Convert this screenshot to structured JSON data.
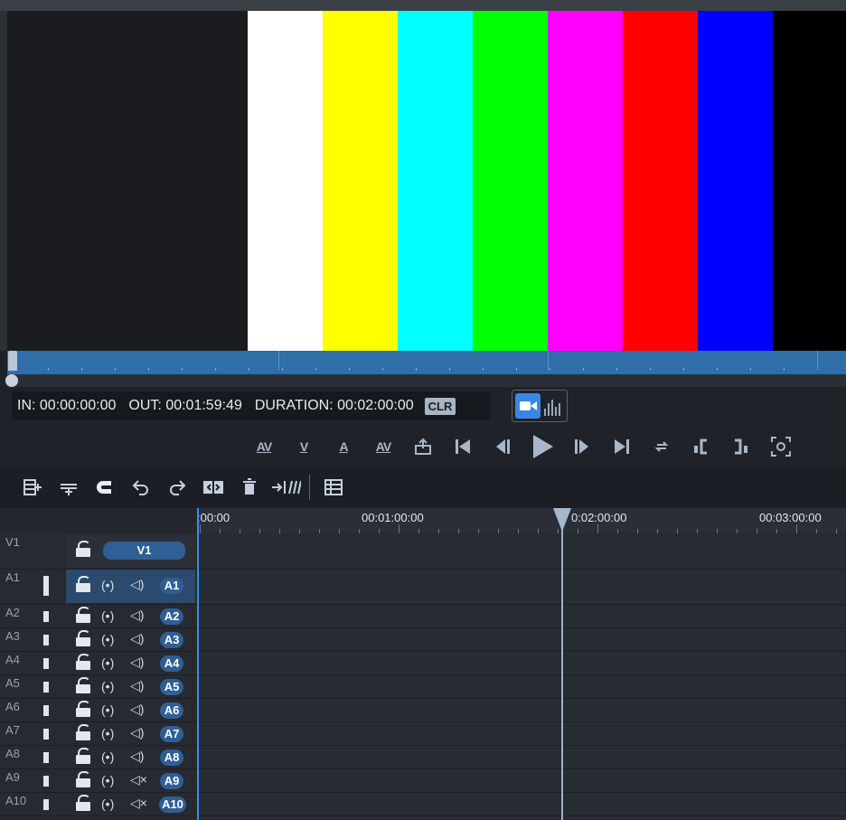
{
  "viewer": {
    "colorbars": [
      "#ffffff",
      "#ffff00",
      "#00ffff",
      "#00ff00",
      "#ff00ff",
      "#ff0000",
      "#0000ff",
      "#000000"
    ]
  },
  "info": {
    "in": "IN: 00:00:00:00",
    "out": "OUT: 00:01:59:49",
    "duration": "DURATION: 00:02:00:00",
    "clr": "CLR"
  },
  "transport": {
    "av": "AV",
    "v": "V",
    "a": "A",
    "av2": "AV"
  },
  "ruler": {
    "labels": [
      ":00:00",
      "00:01:00:00",
      "0:02:00:00",
      "00:03:00:00"
    ]
  },
  "tracks": {
    "video": [
      {
        "name": "V1",
        "pill": "V1"
      }
    ],
    "audio": [
      {
        "name": "A1",
        "pill": "A1"
      },
      {
        "name": "A2",
        "pill": "A2"
      },
      {
        "name": "A3",
        "pill": "A3"
      },
      {
        "name": "A4",
        "pill": "A4"
      },
      {
        "name": "A5",
        "pill": "A5"
      },
      {
        "name": "A6",
        "pill": "A6"
      },
      {
        "name": "A7",
        "pill": "A7"
      },
      {
        "name": "A8",
        "pill": "A8"
      },
      {
        "name": "A9",
        "pill": "A9"
      },
      {
        "name": "A10",
        "pill": "A10"
      }
    ]
  },
  "colors": {
    "accent": "#3a86e6",
    "pill": "#2f5f94",
    "scrub": "#2f6ea8"
  }
}
